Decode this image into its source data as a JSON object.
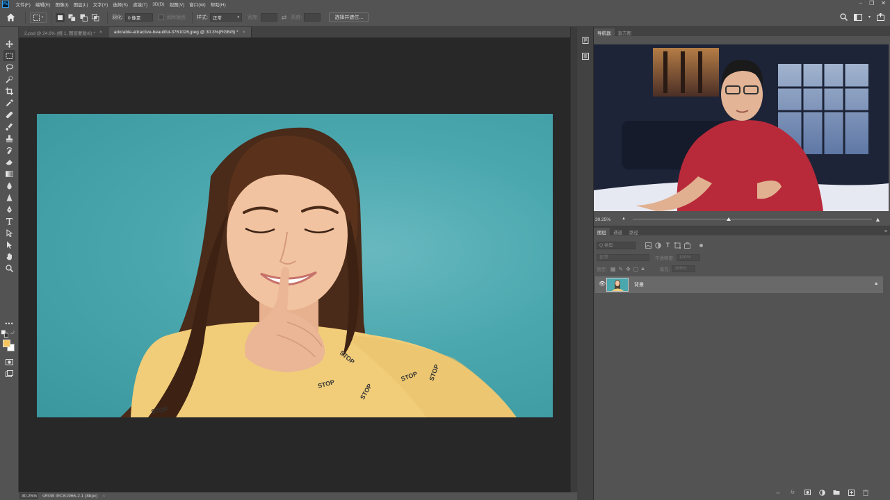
{
  "menu": {
    "items": [
      "文件(F)",
      "编辑(E)",
      "图像(I)",
      "图层(L)",
      "文字(Y)",
      "选择(S)",
      "滤镜(T)",
      "3D(D)",
      "视图(V)",
      "窗口(W)",
      "帮助(H)"
    ]
  },
  "options": {
    "feather_label": "羽化:",
    "feather_value": "0 像素",
    "antialias_label": "消除锯齿",
    "style_label": "样式:",
    "style_value": "正常",
    "width_label": "宽度:",
    "height_label": "高度:",
    "select_mask_button": "选择并遮住..."
  },
  "tabs": [
    {
      "label": "2.psd @ 24.6% (组 1, 图层蒙版/8) *",
      "active": false
    },
    {
      "label": "adorable-attractive-beautiful-3761026.jpeg @ 30.3%(RGB/8) *",
      "active": true
    }
  ],
  "canvas": {
    "shirt_print": "STOP"
  },
  "status": {
    "zoom": "30.25%",
    "profile": "sRGB IEC61966-2.1 (8bpc)",
    "chevron": "›"
  },
  "navigator": {
    "tabs": [
      "导航器",
      "直方图"
    ],
    "zoom": "30.25%"
  },
  "layers": {
    "tabs": [
      "图层",
      "通道",
      "路径"
    ],
    "kind_placeholder": "Q 类型",
    "blend_mode": "正常",
    "opacity_label": "不透明度:",
    "opacity_value": "100%",
    "lock_label": "锁定:",
    "fill_label": "填充:",
    "fill_value": "100%",
    "items": [
      {
        "name": "背景",
        "visible": true,
        "locked": true
      }
    ]
  },
  "colors": {
    "foreground": "#f3c55c",
    "background": "#ffffff",
    "canvas_bg": "#4aa7ae"
  }
}
